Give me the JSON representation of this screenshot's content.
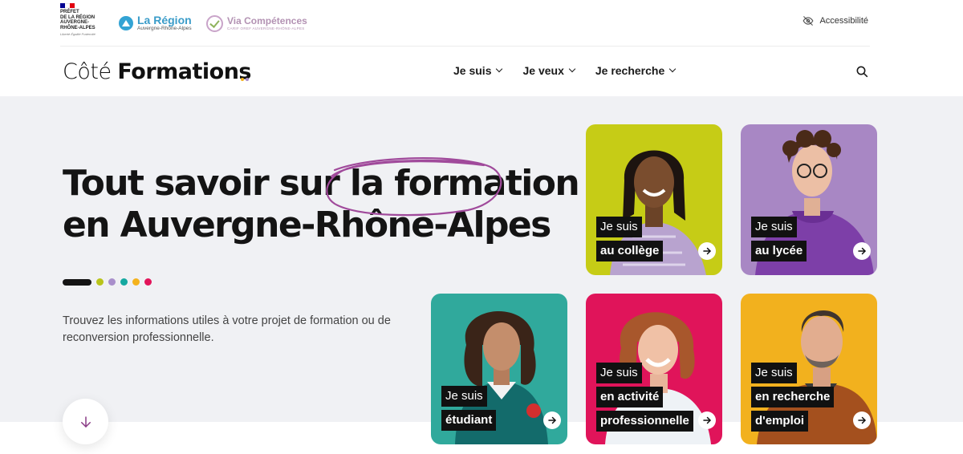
{
  "header": {
    "prefet_lines": [
      "PRÉFET",
      "DE LA RÉGION",
      "AUVERGNE-",
      "RHÔNE-ALPES"
    ],
    "prefet_motto": "Liberté Égalité Fraternité",
    "region_title": "La Région",
    "region_sub": "Auvergne-Rhône-Alpes",
    "via_title": "Via Compétences",
    "via_sub": "CARIF OREF AUVERGNE-RHÔNE-ALPES",
    "accessibility_label": "Accessibilité"
  },
  "nav": {
    "logo_part1": "Côté",
    "logo_part2": "Formations",
    "items": [
      {
        "label": "Je suis"
      },
      {
        "label": "Je veux"
      },
      {
        "label": "Je recherche"
      }
    ],
    "icons": {
      "search": "search-icon",
      "accessibility": "eye-off-icon"
    }
  },
  "hero": {
    "title_line1_a": "Tout savoir sur la ",
    "title_line1_b": "formation",
    "title_line2": "en Auvergne-Rhône-Alpes",
    "description": "Trouvez les informations utiles à votre projet de formation ou de reconversion professionnelle.",
    "dot_colors": [
      "#141414",
      "#b9c41a",
      "#a98fcb",
      "#14a8a0",
      "#f4b21c",
      "#e2145a"
    ],
    "highlight_color": "#a04a9b"
  },
  "cards": [
    {
      "line1": "Je suis",
      "line2": "au collège",
      "bg": "#c6cc16"
    },
    {
      "line1": "Je suis",
      "line2": "au lycée",
      "bg": "#a887c4"
    },
    {
      "line1": "Je suis",
      "line2": "étudiant",
      "bg": "#30a99c"
    },
    {
      "line1": "Je suis",
      "line2": "en activité",
      "line3": "professionnelle",
      "bg": "#e0145a"
    },
    {
      "line1": "Je suis",
      "line2": "en recherche",
      "line3": "d'emploi",
      "bg": "#f2b11e"
    }
  ]
}
